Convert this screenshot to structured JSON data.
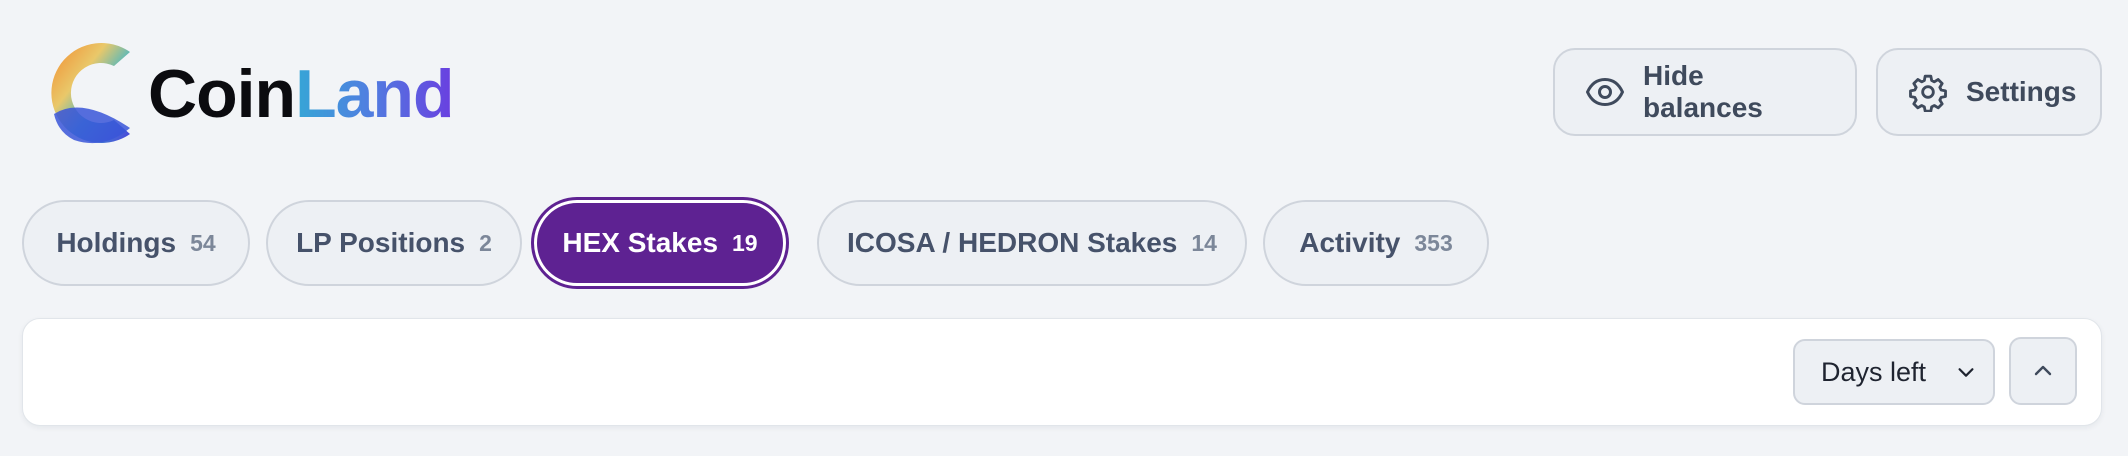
{
  "brand": {
    "name_part1": "Coin",
    "name_part2": "Land"
  },
  "header": {
    "hide_balances_label": "Hide balances",
    "settings_label": "Settings"
  },
  "tabs": [
    {
      "label": "Holdings",
      "count": "54"
    },
    {
      "label": "LP Positions",
      "count": "2"
    },
    {
      "label": "HEX Stakes",
      "count": "19"
    },
    {
      "label": "ICOSA / HEDRON Stakes",
      "count": "14"
    },
    {
      "label": "Activity",
      "count": "353"
    }
  ],
  "active_tab": "HEX Stakes",
  "sort": {
    "selected": "Days left"
  },
  "colors": {
    "accent": "#5e2292",
    "background": "#f2f4f7"
  },
  "icons": {
    "hide_balances": "eye-icon",
    "settings": "gear-icon",
    "sort": "chevron-down-icon",
    "collapse": "chevron-up-icon"
  }
}
